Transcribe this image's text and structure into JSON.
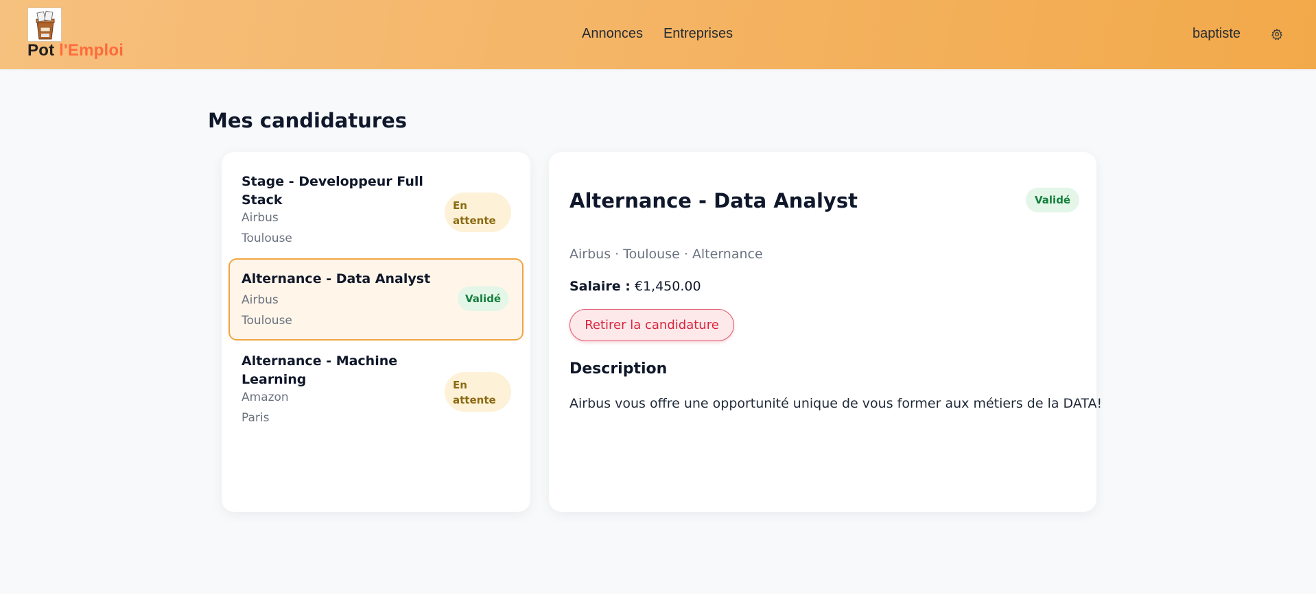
{
  "brand": {
    "part1": "Pot",
    "part2": "l'Emploi"
  },
  "nav": {
    "items": [
      {
        "label": "Annonces"
      },
      {
        "label": "Entreprises"
      }
    ]
  },
  "user": {
    "name": "baptiste",
    "settings_icon": "gear-icon"
  },
  "page": {
    "title": "Mes candidatures"
  },
  "applications": [
    {
      "title": "Stage - Developpeur Full Stack",
      "company": "Airbus",
      "city": "Toulouse",
      "status": "En attente",
      "status_color": "#8a6a12",
      "selected": false
    },
    {
      "title": "Alternance - Data Analyst",
      "company": "Airbus",
      "city": "Toulouse",
      "status": "Validé",
      "status_color": "#15803d",
      "selected": true
    },
    {
      "title": "Alternance - Machine Learning",
      "company": "Amazon",
      "city": "Paris",
      "status": "En attente",
      "status_color": "#8a6a12",
      "selected": false
    }
  ],
  "detail": {
    "title": "Alternance - Data Analyst",
    "status": "Validé",
    "meta": "Airbus · Toulouse · Alternance",
    "salary_label": "Salaire :",
    "salary_value": "€1,450.00",
    "withdraw_label": "Retirer la candidature",
    "description_heading": "Description",
    "description": "Airbus vous offre une opportunité unique de vous former aux métiers de la DATA!"
  },
  "colors": {
    "accent": "#f0a542",
    "brand_orange": "#ff6a3d",
    "danger": "#d7263d",
    "success": "#15803d"
  }
}
